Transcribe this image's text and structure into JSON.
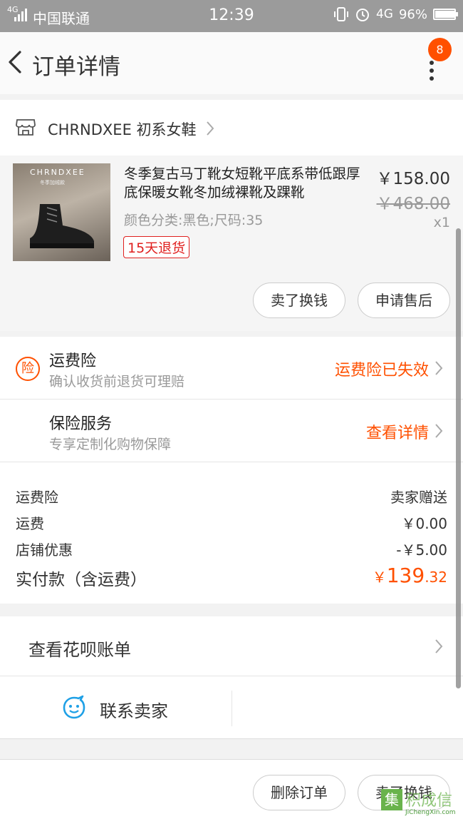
{
  "status_bar": {
    "network_small": "4G",
    "carrier": "中国联通",
    "time": "12:39",
    "network": "4G",
    "battery": "96%",
    "battery_level": 0.96
  },
  "nav": {
    "title": "订单详情",
    "badge_count": "8"
  },
  "shop": {
    "name": "CHRNDXEE 初系女鞋"
  },
  "product": {
    "thumb_brand": "CHRNDXEE",
    "thumb_sub": "冬季加绒款",
    "title": "冬季复古马丁靴女短靴平底系带低跟厚底保暖女靴冬加绒裸靴及踝靴",
    "variant": "颜色分类:黑色;尺码:35",
    "return_tag": "15天退货",
    "price": "￥158.00",
    "original_price": "￥468.00",
    "quantity": "x1",
    "buttons": [
      "卖了换钱",
      "申请售后"
    ]
  },
  "insurance": {
    "shipping": {
      "title": "运费险",
      "subtitle": "确认收货前退货可理赔",
      "status": "运费险已失效",
      "icon_char": "险"
    },
    "service": {
      "title": "保险服务",
      "subtitle": "专享定制化购物保障",
      "action": "查看详情"
    }
  },
  "summary": {
    "rows": [
      {
        "label": "运费险",
        "value": "卖家赠送"
      },
      {
        "label": "运费",
        "value": "￥0.00"
      },
      {
        "label": "店铺优惠",
        "value": "-￥5.00"
      }
    ],
    "total_label": "实付款（含运费）",
    "total_currency": "￥",
    "total_integer": "139",
    "total_decimal": ".32"
  },
  "huabei": {
    "label": "查看花呗账单"
  },
  "contact": {
    "label": "联系卖家"
  },
  "bottom": {
    "buttons": [
      "删除订单",
      "卖了换钱"
    ]
  },
  "watermark": {
    "icon_char": "集",
    "text": "积成信",
    "url": "JiChengXin.com"
  },
  "colors": {
    "accent": "#ff5000",
    "tag_red": "#e0201f",
    "contact_blue": "#1ea0e6",
    "status_bar": "#9b9b9b"
  }
}
